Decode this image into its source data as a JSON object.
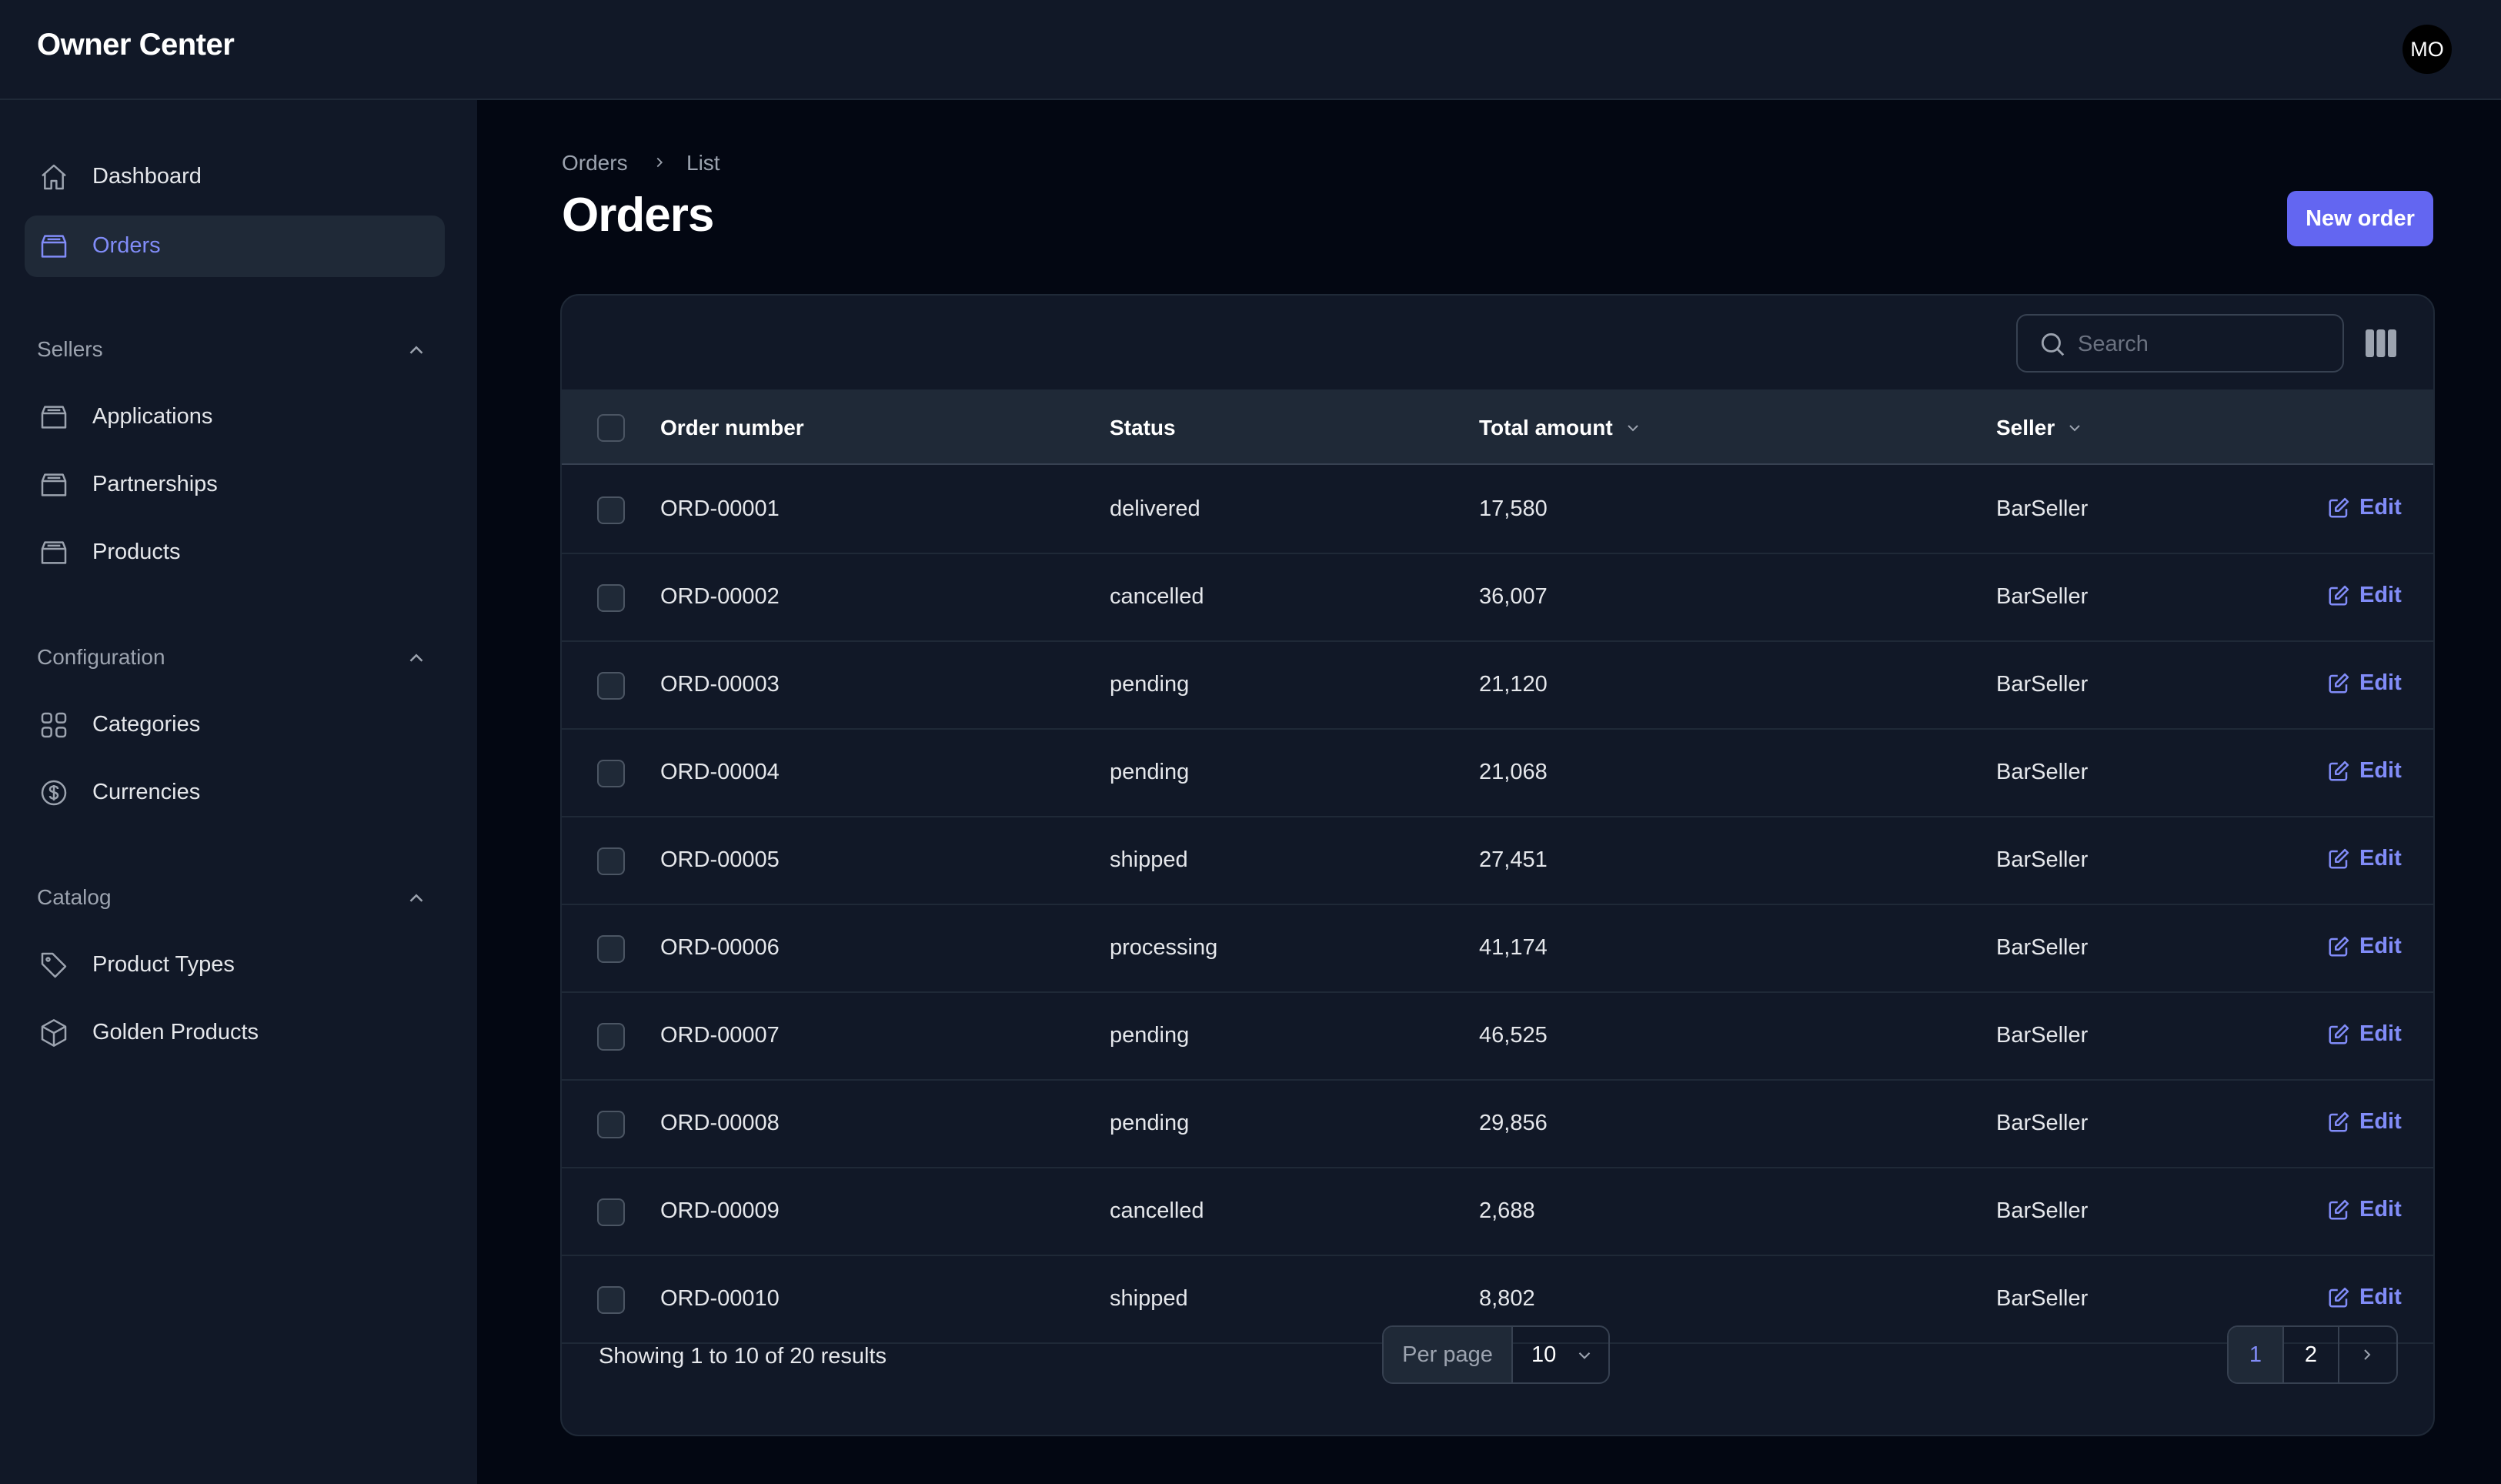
{
  "app": {
    "brand": "Owner Center",
    "avatar_initials": "MO"
  },
  "sidebar": {
    "top_items": [
      {
        "label": "Dashboard",
        "icon": "home-icon",
        "active": false
      },
      {
        "label": "Orders",
        "icon": "box-icon",
        "active": true
      }
    ],
    "groups": [
      {
        "title": "Sellers",
        "items": [
          {
            "label": "Applications",
            "icon": "box-icon"
          },
          {
            "label": "Partnerships",
            "icon": "box-icon"
          },
          {
            "label": "Products",
            "icon": "box-icon"
          }
        ]
      },
      {
        "title": "Configuration",
        "items": [
          {
            "label": "Categories",
            "icon": "grid-icon"
          },
          {
            "label": "Currencies",
            "icon": "dollar-icon"
          }
        ]
      },
      {
        "title": "Catalog",
        "items": [
          {
            "label": "Product Types",
            "icon": "tag-icon"
          },
          {
            "label": "Golden Products",
            "icon": "cube-icon"
          }
        ]
      }
    ]
  },
  "breadcrumb": {
    "parent": "Orders",
    "current": "List"
  },
  "page": {
    "title": "Orders",
    "new_button": "New order"
  },
  "table": {
    "search_placeholder": "Search",
    "columns": {
      "order_number": "Order number",
      "status": "Status",
      "total_amount": "Total amount",
      "seller": "Seller"
    },
    "edit_label": "Edit",
    "rows": [
      {
        "order_number": "ORD-00001",
        "status": "delivered",
        "total": "17,580",
        "seller": "BarSeller"
      },
      {
        "order_number": "ORD-00002",
        "status": "cancelled",
        "total": "36,007",
        "seller": "BarSeller"
      },
      {
        "order_number": "ORD-00003",
        "status": "pending",
        "total": "21,120",
        "seller": "BarSeller"
      },
      {
        "order_number": "ORD-00004",
        "status": "pending",
        "total": "21,068",
        "seller": "BarSeller"
      },
      {
        "order_number": "ORD-00005",
        "status": "shipped",
        "total": "27,451",
        "seller": "BarSeller"
      },
      {
        "order_number": "ORD-00006",
        "status": "processing",
        "total": "41,174",
        "seller": "BarSeller"
      },
      {
        "order_number": "ORD-00007",
        "status": "pending",
        "total": "46,525",
        "seller": "BarSeller"
      },
      {
        "order_number": "ORD-00008",
        "status": "pending",
        "total": "29,856",
        "seller": "BarSeller"
      },
      {
        "order_number": "ORD-00009",
        "status": "cancelled",
        "total": "2,688",
        "seller": "BarSeller"
      },
      {
        "order_number": "ORD-00010",
        "status": "shipped",
        "total": "8,802",
        "seller": "BarSeller"
      }
    ],
    "footer": {
      "summary": "Showing 1 to 10 of 20 results",
      "per_page_label": "Per page",
      "per_page_value": "10",
      "pages": [
        "1",
        "2"
      ],
      "current_page": "1"
    }
  },
  "colors": {
    "accent": "#6366f1",
    "accent_text": "#818cf8",
    "background": "#030712",
    "surface": "#111827"
  }
}
